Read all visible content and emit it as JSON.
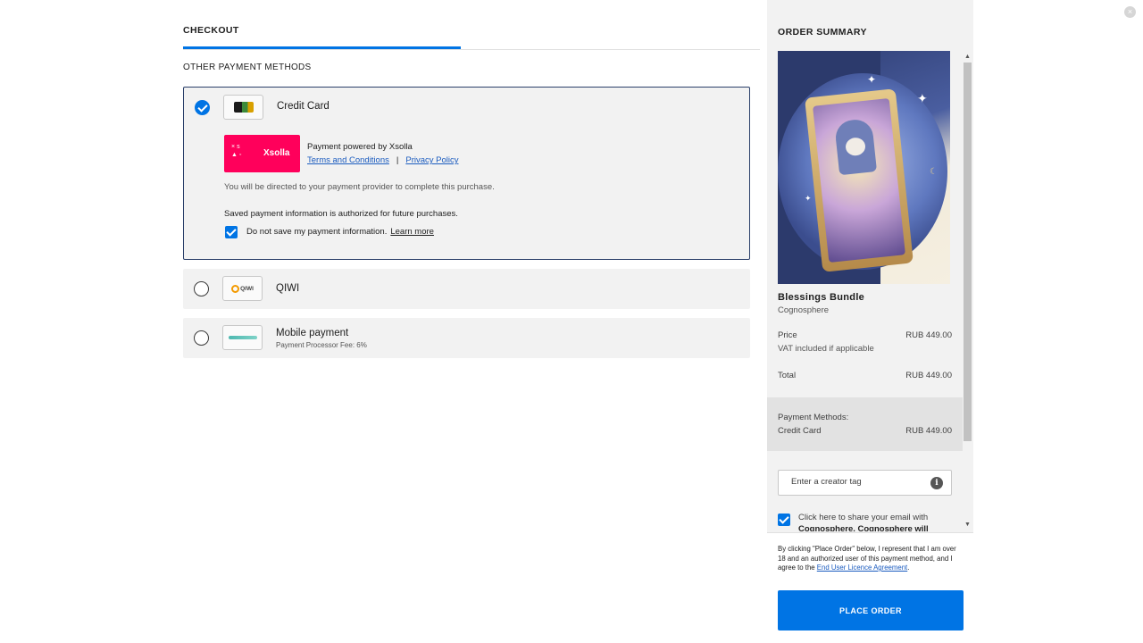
{
  "checkout": {
    "tab_label": "CHECKOUT",
    "section_title": "OTHER PAYMENT METHODS",
    "methods": [
      {
        "name": "Credit Card",
        "selected": true,
        "icon": "credit-card-logo",
        "powered_by": "Payment powered by Xsolla",
        "xsolla_logo": "Xsolla",
        "terms_link": "Terms and Conditions",
        "separator": "|",
        "privacy_link": "Privacy Policy",
        "redirect_note": "You will be directed to your payment provider to complete this purchase.",
        "saved_info": "Saved payment information is authorized for future purchases.",
        "do_not_save_label": "Do not save my payment information.",
        "do_not_save_checked": true,
        "learn_more": "Learn more"
      },
      {
        "name": "QIWI",
        "selected": false,
        "icon": "qiwi-logo",
        "logo_text": "QIWI"
      },
      {
        "name": "Mobile payment",
        "selected": false,
        "icon": "mobile-payment-logo",
        "fee_note": "Payment Processor Fee: 6%"
      }
    ]
  },
  "summary": {
    "title": "ORDER SUMMARY",
    "product_name": "Blessings Bundle",
    "publisher": "Cognosphere",
    "price_label": "Price",
    "price_value": "RUB 449.00",
    "vat_note": "VAT included if applicable",
    "total_label": "Total",
    "total_value": "RUB 449.00",
    "payment_methods_label": "Payment Methods:",
    "payment_method_name": "Credit Card",
    "payment_method_value": "RUB 449.00",
    "creator_tag_placeholder": "Enter a creator tag",
    "share_email_checked": true,
    "share_email_text": "Click here to share your email with",
    "share_email_text_2": "Cognosphere. Cognosphere will",
    "legal_text": "By clicking \"Place Order\" below, I represent that I am over 18 and an authorized user of this payment method, and I agree to the",
    "eula_link": "End User Licence Agreement",
    "legal_end": ".",
    "place_order_label": "PLACE ORDER"
  },
  "window": {
    "close_glyph": "×"
  },
  "colors": {
    "accent": "#0074e4",
    "xsolla": "#ff005b",
    "panel": "#f2f2f2",
    "selected_border": "#2a3f69"
  }
}
